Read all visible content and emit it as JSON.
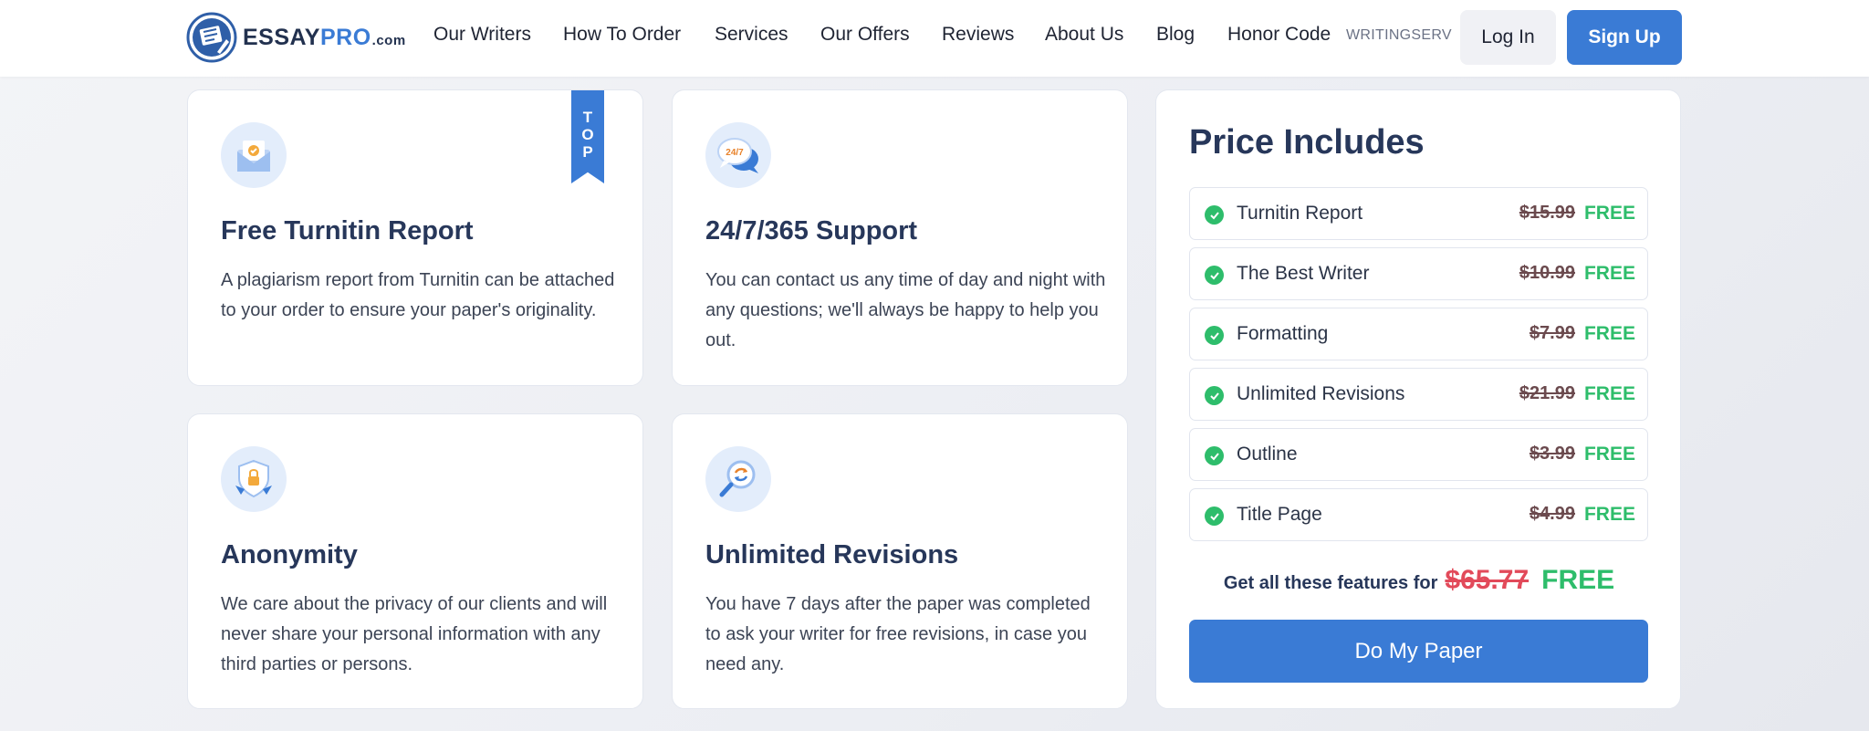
{
  "header": {
    "logo": {
      "brand_main": "ESSAY",
      "brand_accent": "PRO",
      "brand_suffix": ".com"
    },
    "nav": [
      {
        "label": "Our Writers"
      },
      {
        "label": "How To Order"
      },
      {
        "label": "Services"
      },
      {
        "label": "Our Offers"
      },
      {
        "label": "Reviews"
      },
      {
        "label": "About Us"
      },
      {
        "label": "Blog"
      },
      {
        "label": "Honor Code"
      }
    ],
    "promo_label": "WRITINGSERV",
    "login_label": "Log In",
    "signup_label": "Sign Up"
  },
  "features": [
    {
      "icon": "envelope-check-icon",
      "title": "Free Turnitin Report",
      "description": "A plagiarism report from Turnitin can be attached to your order to ensure your paper's originality.",
      "ribbon": [
        "T",
        "O",
        "P"
      ]
    },
    {
      "icon": "support-chat-247-icon",
      "title": "24/7/365 Support",
      "description": "You can contact us any time of day and night with any questions; we'll always be happy to help you out.",
      "icon_text": "24/7"
    },
    {
      "icon": "shield-lock-icon",
      "title": "Anonymity",
      "description": "We care about the privacy of our clients and will never share your personal information with any third parties or persons."
    },
    {
      "icon": "magnifier-refresh-icon",
      "title": "Unlimited Revisions",
      "description": "You have 7 days after the paper was completed to ask your writer for free revisions, in case you need any."
    }
  ],
  "price_panel": {
    "title": "Price Includes",
    "items": [
      {
        "label": "Turnitin Report",
        "old_price": "$15.99",
        "price": "FREE"
      },
      {
        "label": "The Best Writer",
        "old_price": "$10.99",
        "price": "FREE"
      },
      {
        "label": "Formatting",
        "old_price": "$7.99",
        "price": "FREE"
      },
      {
        "label": "Unlimited Revisions",
        "old_price": "$21.99",
        "price": "FREE"
      },
      {
        "label": "Outline",
        "old_price": "$3.99",
        "price": "FREE"
      },
      {
        "label": "Title Page",
        "old_price": "$4.99",
        "price": "FREE"
      }
    ],
    "summary_text": "Get all these features for",
    "summary_old_price": "$65.77",
    "summary_price": "FREE",
    "cta_label": "Do My Paper"
  },
  "colors": {
    "accent": "#3a7bd5",
    "heading": "#27375a",
    "success": "#2ebd6b",
    "strike_red": "#e24a5a",
    "icon_bg": "#e3edfb"
  }
}
